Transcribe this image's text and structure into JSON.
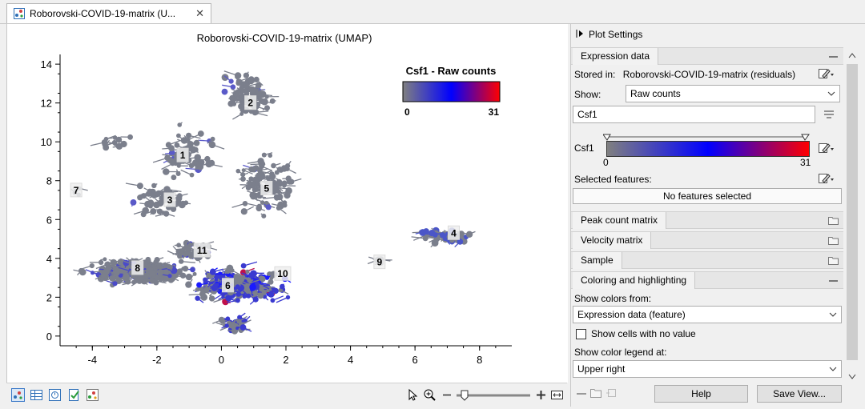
{
  "tab": {
    "title": "Roborovski-COVID-19-matrix (U...",
    "close": "✕"
  },
  "plot": {
    "title": "Roborovski-COVID-19-matrix (UMAP)",
    "legend_title": "Csf1 - Raw counts",
    "legend_min": "0",
    "legend_max": "31",
    "cluster_labels": [
      "1",
      "2",
      "3",
      "4",
      "5",
      "6",
      "7",
      "8",
      "9",
      "10",
      "11"
    ]
  },
  "chart_data": {
    "type": "scatter",
    "title": "Roborovski-COVID-19-matrix (UMAP)",
    "xlim": [
      -5,
      9
    ],
    "ylim": [
      -0.5,
      14.5
    ],
    "x_ticks": [
      "-4",
      "-2",
      "0",
      "2",
      "4",
      "6",
      "8"
    ],
    "y_ticks": [
      "0",
      "2",
      "4",
      "6",
      "8",
      "10",
      "12",
      "14"
    ],
    "clusters": [
      {
        "label": "1",
        "x": -1.2,
        "y": 9.3
      },
      {
        "label": "2",
        "x": 0.9,
        "y": 12.0
      },
      {
        "label": "3",
        "x": -1.6,
        "y": 7.0
      },
      {
        "label": "4",
        "x": 7.2,
        "y": 5.3
      },
      {
        "label": "5",
        "x": 1.4,
        "y": 7.6
      },
      {
        "label": "6",
        "x": 0.2,
        "y": 2.6
      },
      {
        "label": "7",
        "x": -4.5,
        "y": 7.5
      },
      {
        "label": "8",
        "x": -2.6,
        "y": 3.5
      },
      {
        "label": "9",
        "x": 4.9,
        "y": 3.8
      },
      {
        "label": "10",
        "x": 1.9,
        "y": 3.2
      },
      {
        "label": "11",
        "x": -0.6,
        "y": 4.4
      }
    ],
    "color_legend": {
      "feature": "Csf1",
      "min": 0,
      "max": 31,
      "colors": [
        "#808080",
        "#0000ff",
        "#ff0000"
      ]
    }
  },
  "settings": {
    "header": "Plot Settings",
    "expression_tab": "Expression data",
    "stored_in_label": "Stored in:",
    "stored_in_value": "Roborovski-COVID-19-matrix (residuals)",
    "show_label": "Show:",
    "show_value": "Raw counts",
    "feature_input": "Csf1",
    "gradient_label": "Csf1",
    "gradient_min": "0",
    "gradient_max": "31",
    "selected_features_label": "Selected features:",
    "no_features": "No features selected",
    "peak_tab": "Peak count matrix",
    "velocity_tab": "Velocity matrix",
    "sample_tab": "Sample",
    "coloring_tab": "Coloring and highlighting",
    "show_colors_label": "Show colors from:",
    "show_colors_value": "Expression data (feature)",
    "no_value_checkbox": "Show cells with no value",
    "legend_at_label": "Show color legend at:",
    "legend_at_value": "Upper right",
    "help_button": "Help",
    "save_view_button": "Save View..."
  }
}
